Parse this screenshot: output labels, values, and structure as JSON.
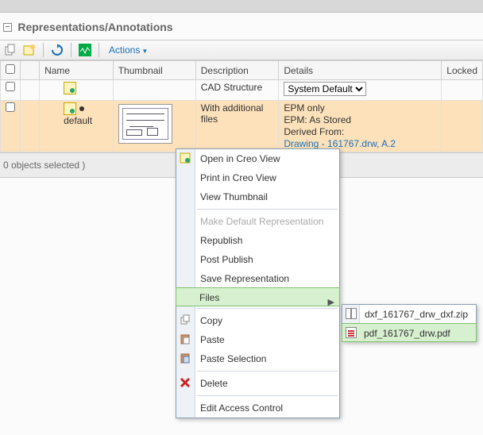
{
  "section": {
    "title": "Representations/Annotations"
  },
  "toolbar": {
    "actions_label": "Actions"
  },
  "columns": {
    "name": "Name",
    "thumbnail": "Thumbnail",
    "description": "Description",
    "details": "Details",
    "locked": "Locked"
  },
  "row1": {
    "description": "CAD Structure",
    "details_select": "System Default",
    "details_options": [
      "System Default"
    ]
  },
  "row2": {
    "name": "default",
    "description": "With additional files",
    "details_line1": "EPM only",
    "details_line2": "EPM: As Stored",
    "details_line3_prefix": "Derived From: ",
    "details_line3_link": "Drawing - 161767.drw, A.2"
  },
  "footer": {
    "selection": "0 objects selected )"
  },
  "context_menu": {
    "open_creo": "Open in Creo View",
    "print_creo": "Print in Creo View",
    "view_thumb": "View Thumbnail",
    "make_default": "Make Default Representation",
    "republish": "Republish",
    "post_publish": "Post Publish",
    "save_rep": "Save Representation",
    "files": "Files",
    "copy": "Copy",
    "paste": "Paste",
    "paste_selection": "Paste Selection",
    "delete": "Delete",
    "edit_access": "Edit Access Control"
  },
  "submenu": {
    "file1": "dxf_161767_drw_dxf.zip",
    "file2": "pdf_161767_drw.pdf"
  }
}
